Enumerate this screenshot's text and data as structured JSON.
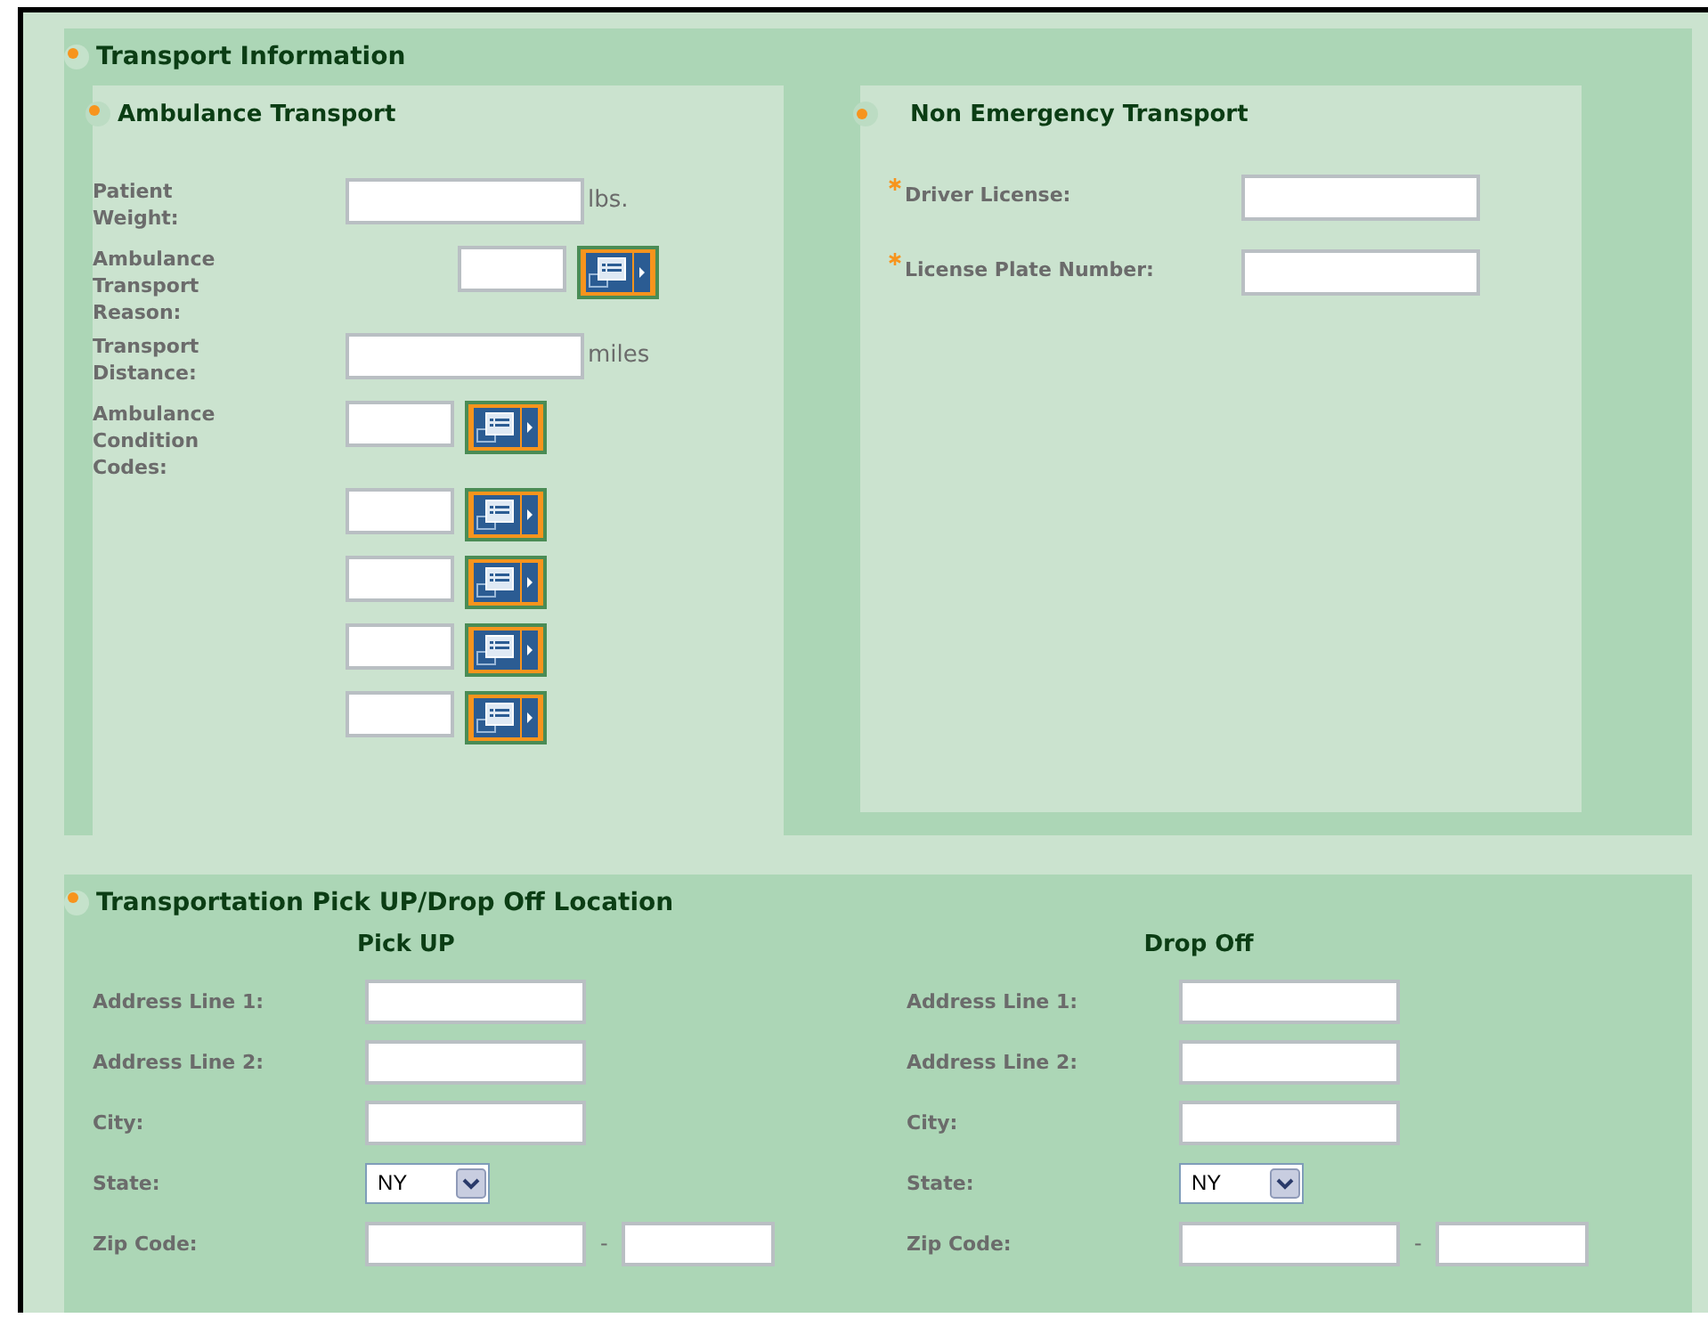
{
  "title": "Transport Information",
  "ambulance": {
    "title": "Ambulance Transport",
    "fields": [
      {
        "kind": "text",
        "label": "Patient Weight:",
        "unit": "lbs."
      },
      {
        "kind": "lookup",
        "label": "Ambulance Transport Reason:"
      },
      {
        "kind": "text",
        "label": "Transport Distance:",
        "unit": "miles"
      },
      {
        "kind": "lookup",
        "label": "Ambulance Condition Codes:"
      },
      {
        "kind": "lookup"
      },
      {
        "kind": "lookup"
      },
      {
        "kind": "lookup"
      },
      {
        "kind": "lookup"
      }
    ]
  },
  "non_emergency": {
    "title": "Non Emergency Transport",
    "fields": [
      {
        "label": "Driver License:",
        "required": true
      },
      {
        "label": "License Plate Number:",
        "required": true
      }
    ]
  },
  "location": {
    "title": "Transportation Pick UP/Drop Off Location",
    "columns": [
      {
        "heading": "Pick UP",
        "fields": [
          {
            "kind": "text",
            "label": "Address Line 1:"
          },
          {
            "kind": "text",
            "label": "Address Line 2:"
          },
          {
            "kind": "text",
            "label": "City:"
          },
          {
            "kind": "select",
            "label": "State:",
            "value": "NY"
          },
          {
            "kind": "zip",
            "label": "Zip Code:",
            "separator": "-"
          }
        ]
      },
      {
        "heading": "Drop Off",
        "fields": [
          {
            "kind": "text",
            "label": "Address Line 1:"
          },
          {
            "kind": "text",
            "label": "Address Line 2:"
          },
          {
            "kind": "text",
            "label": "City:"
          },
          {
            "kind": "select",
            "label": "State:",
            "value": "NY"
          },
          {
            "kind": "zip",
            "label": "Zip Code:",
            "separator": "-"
          }
        ]
      }
    ]
  }
}
